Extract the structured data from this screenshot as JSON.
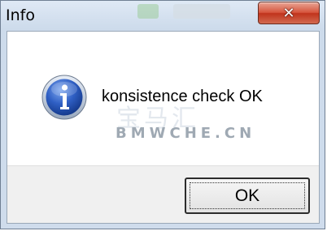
{
  "window": {
    "title": "Info",
    "close_glyph": "✕"
  },
  "message": {
    "text": "konsistence check OK",
    "icon": "info-icon"
  },
  "watermark": {
    "zh": "宝马汇",
    "en": "BMWCHE.CN"
  },
  "buttons": {
    "ok_label": "OK"
  },
  "colors": {
    "icon_blue": "#1f4fae",
    "close_red": "#c0331c",
    "footer_gray": "#f0f0f0"
  }
}
